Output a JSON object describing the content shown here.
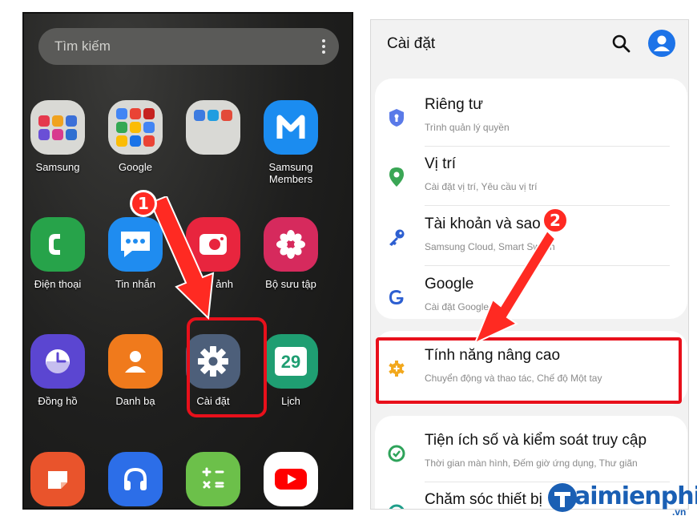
{
  "home": {
    "search_placeholder": "Tìm kiếm",
    "apps": [
      {
        "label": "Samsung"
      },
      {
        "label": "Google"
      },
      {
        "label": ""
      },
      {
        "label": "Samsung\nMembers"
      },
      {
        "label": "Điện thoại"
      },
      {
        "label": "Tin nhắn"
      },
      {
        "label": "Máy ảnh"
      },
      {
        "label": "Bộ sưu tập"
      },
      {
        "label": "Đồng hồ"
      },
      {
        "label": "Danh bạ"
      },
      {
        "label": "Cài đặt"
      },
      {
        "label": "Lịch",
        "icon_text": "29"
      }
    ],
    "step_badge": "1"
  },
  "settings": {
    "title": "Cài đặt",
    "items": [
      {
        "title": "Riêng tư",
        "subtitle": "Trình quản lý quyền",
        "icon": "shield-icon"
      },
      {
        "title": "Vị trí",
        "subtitle": "Cài đặt vị trí, Yêu cầu vị trí",
        "icon": "location-pin-icon"
      },
      {
        "title": "Tài khoản và sao lưu",
        "subtitle": "Samsung Cloud, Smart Switch",
        "icon": "key-icon"
      },
      {
        "title": "Google",
        "subtitle": "Cài đặt Google",
        "icon": "google-icon"
      },
      {
        "title": "Tính năng nâng cao",
        "subtitle": "Chuyển động và thao tác, Chế độ Một tay",
        "icon": "gear-plus-icon"
      },
      {
        "title": "Tiện ích số và kiểm soát truy cập",
        "subtitle": "Thời gian màn hình, Đếm giờ ứng dụng, Thư giãn",
        "icon": "digital-wellbeing-icon"
      },
      {
        "title": "Chăm sóc thiết bị",
        "subtitle": "",
        "icon": "device-care-icon"
      }
    ],
    "step_badge": "2"
  },
  "watermark": {
    "text": "aimienphi",
    "suffix": ".vn"
  },
  "colors": {
    "highlight": "#e8101b",
    "accent": "#1d73e8",
    "badge": "#ff2a22"
  }
}
